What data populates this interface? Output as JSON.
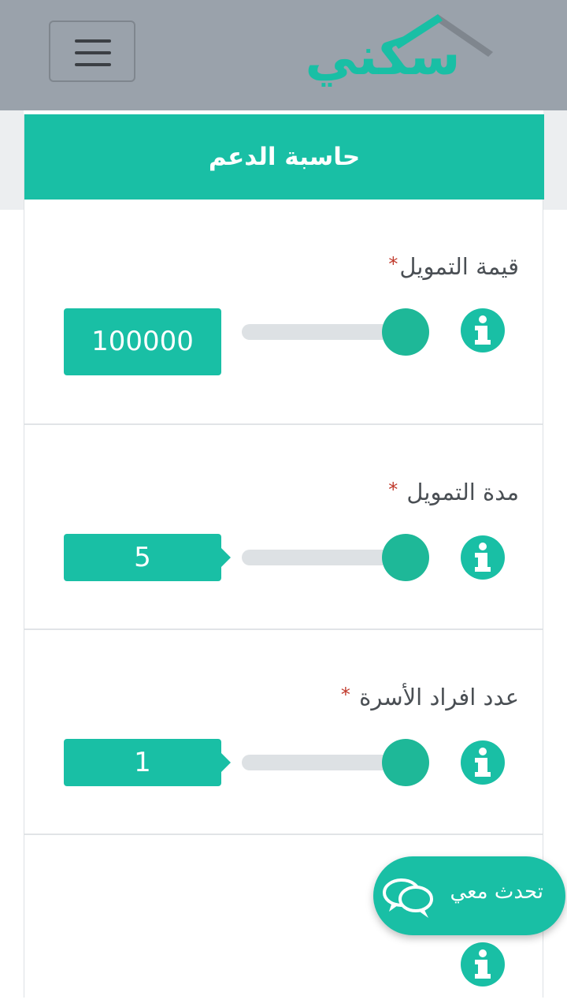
{
  "header": {
    "logo_text": "سكني",
    "menu_icon": "hamburger-menu-icon"
  },
  "calculator": {
    "title": "حاسبة الدعم",
    "fields": [
      {
        "label": "قيمة التمويل",
        "required_mark": "*",
        "value": "100000",
        "icon": "info-icon"
      },
      {
        "label": "مدة التمويل",
        "required_mark": "*",
        "value": "5",
        "icon": "info-icon"
      },
      {
        "label": "عدد افراد الأسرة",
        "required_mark": "*",
        "value": "1",
        "icon": "info-icon"
      },
      {
        "required_mark": "*",
        "icon": "info-icon"
      }
    ]
  },
  "chat": {
    "label": "تحدث معي",
    "icon": "chat-bubbles-icon"
  },
  "colors": {
    "brand": "#19bfa5",
    "topbar": "#9aa2ab",
    "slider_thumb": "#1eb898",
    "required": "#c0392b"
  }
}
